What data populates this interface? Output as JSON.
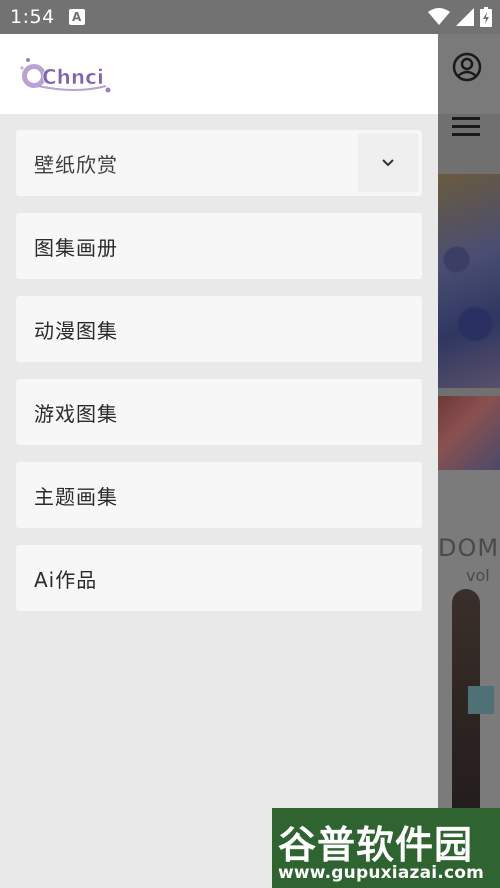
{
  "status_bar": {
    "time": "1:54",
    "notification_icon": "A"
  },
  "background_page": {
    "text_large": "DOM",
    "text_small": "vol"
  },
  "drawer": {
    "logo_text": "Chnci",
    "menu": [
      {
        "label": "壁纸欣赏",
        "expandable": true
      },
      {
        "label": "图集画册"
      },
      {
        "label": "动漫图集"
      },
      {
        "label": "游戏图集"
      },
      {
        "label": "主题画集"
      },
      {
        "label": "Ai作品"
      }
    ]
  },
  "watermark": {
    "title": "谷普软件园",
    "url": "www.gupuxiazai.com"
  },
  "colors": {
    "drawer_bg": "#e9e9e9",
    "item_bg": "#f7f7f7",
    "watermark_green": "#2f6330",
    "status_bar": "#727272"
  }
}
